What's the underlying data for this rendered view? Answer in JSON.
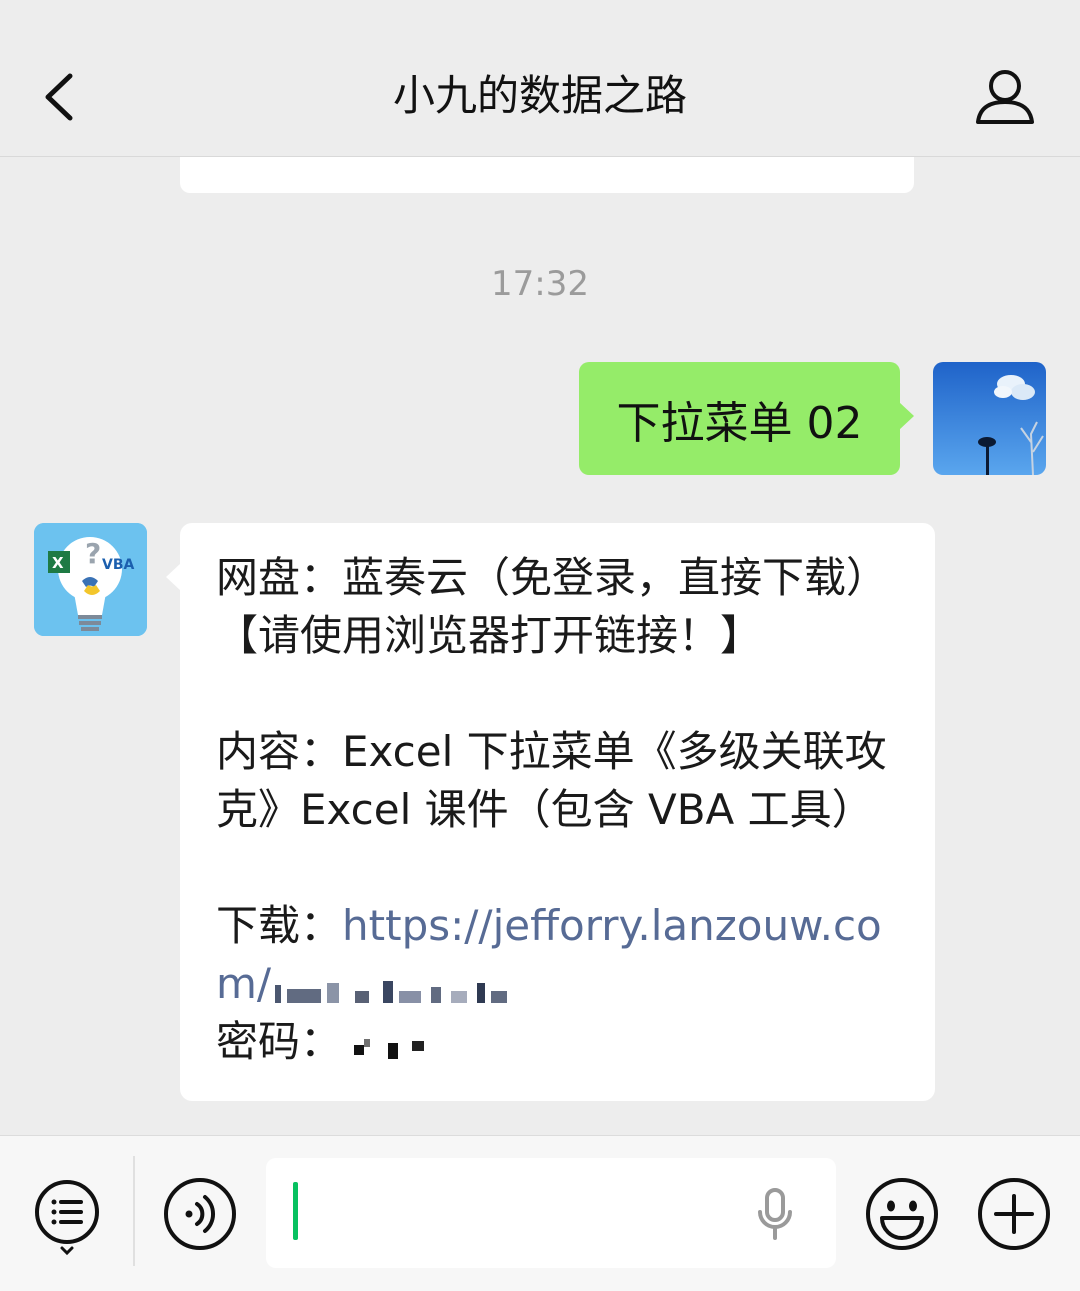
{
  "header": {
    "title": "小九的数据之路"
  },
  "timestamp": "17:32",
  "outgoing_message": {
    "text": "下拉菜单 02"
  },
  "incoming_message": {
    "line1": "网盘：蓝奏云（免登录，直接下载）【请使用浏览器打开链接！】",
    "line2": "内容：Excel 下拉菜单《多级关联攻克》Excel 课件（包含 VBA 工具）",
    "download_label": "下载：",
    "download_link": "https://jefforry.lanzouw.com/",
    "password_label": "密码："
  },
  "bot_avatar": {
    "vba_text": "VBA",
    "x_text": "X"
  },
  "icons": {
    "back": "chevron-left-icon",
    "profile": "person-icon",
    "menu": "list-menu-icon",
    "voice": "voice-icon",
    "mic": "microphone-icon",
    "emoji": "smiley-icon",
    "plus": "plus-icon"
  },
  "colors": {
    "outgoing_bubble": "#95ec69",
    "link": "#576b95",
    "caret": "#07c160",
    "background": "#ededed"
  }
}
